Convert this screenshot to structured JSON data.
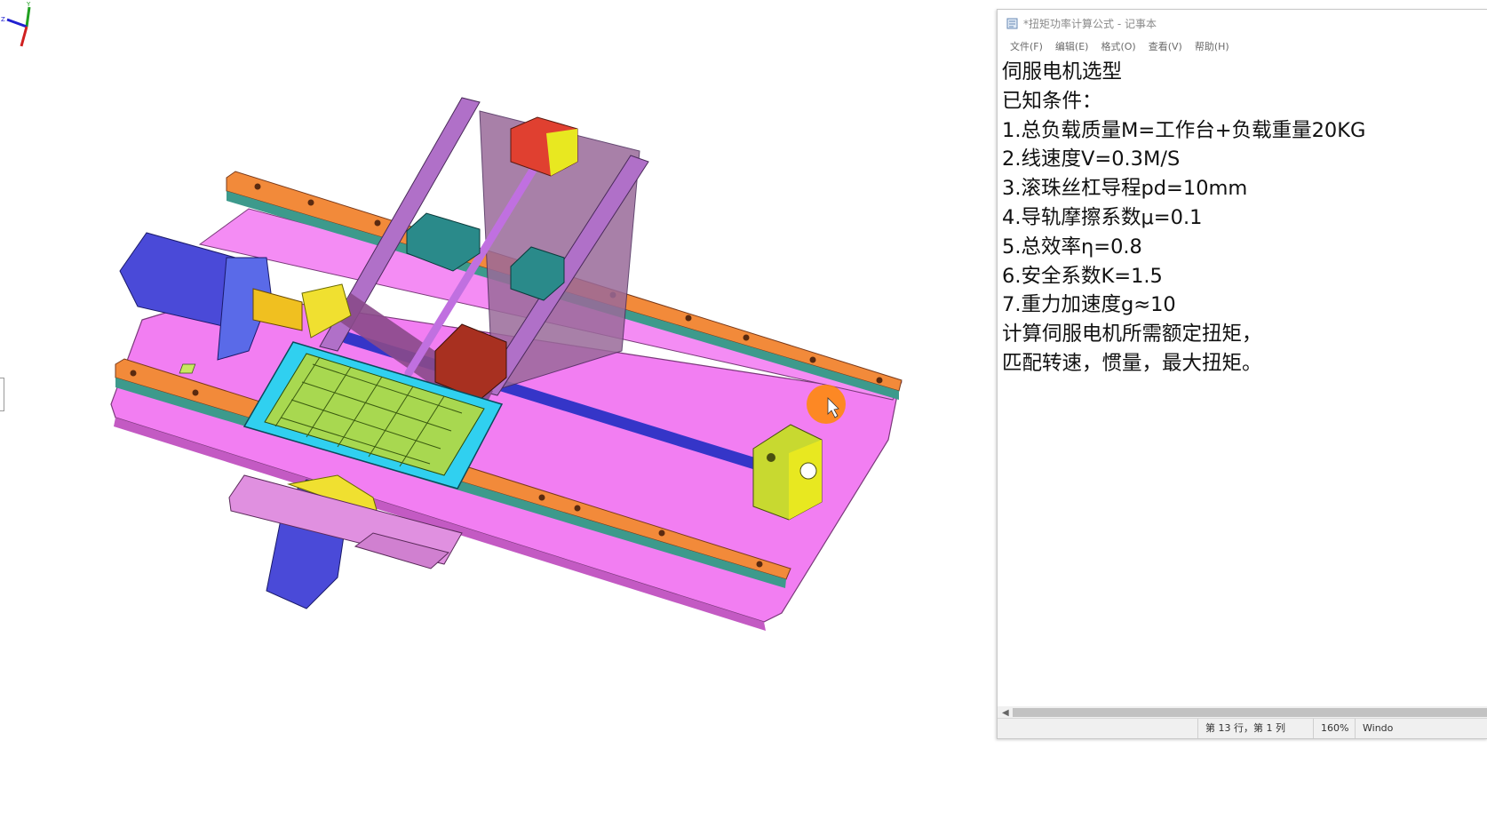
{
  "notepad": {
    "title": "*扭矩功率计算公式 - 记事本",
    "menu": [
      "文件(F)",
      "编辑(E)",
      "格式(O)",
      "查看(V)",
      "帮助(H)"
    ],
    "lines": [
      "伺服电机选型",
      "已知条件：",
      "1.总负载质量M=工作台+负载重量20KG",
      "2.线速度V=0.3M/S",
      "3.滚珠丝杠导程pd=10mm",
      "4.导轨摩擦系数μ=0.1",
      "5.总效率η=0.8",
      "6.安全系数K=1.5",
      "7.重力加速度g≈10",
      "计算伺服电机所需额定扭矩，",
      "匹配转速，惯量，最大扭矩。"
    ],
    "status": {
      "position": "第 13 行，第 1 列",
      "zoom": "160%",
      "line_ending": "Windo"
    }
  },
  "cad": {
    "axis_labels": {
      "y": "Y",
      "z": "Z"
    }
  }
}
